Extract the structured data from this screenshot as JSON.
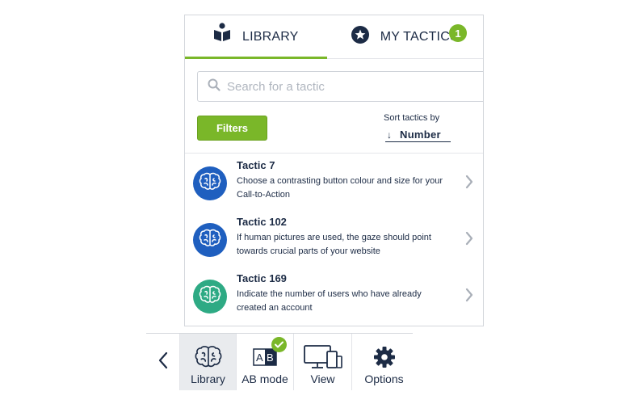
{
  "tabs": [
    {
      "label": "LIBRARY",
      "icon": "book-reader-icon",
      "active": true
    },
    {
      "label": "MY TACTICS",
      "icon": "star-icon",
      "badge": "1"
    }
  ],
  "search": {
    "placeholder": "Search for a tactic",
    "value": ""
  },
  "filters_label": "Filters",
  "sort": {
    "label": "Sort tactics by",
    "value": "Number",
    "direction_icon": "arrow-down-icon"
  },
  "tactics": [
    {
      "title": "Tactic 7",
      "description": "Choose a contrasting button colour and size for your Call-to-Action",
      "color": "#1f5fbf"
    },
    {
      "title": "Tactic 102",
      "description": "If human pictures are used, the gaze should point towards crucial parts of your website",
      "color": "#1f5fbf"
    },
    {
      "title": "Tactic 169",
      "description": "Indicate the number of users who have already created an account",
      "color": "#2eaa84"
    }
  ],
  "toolbar": {
    "back_icon": "chevron-left-icon",
    "items": [
      {
        "label": "Library",
        "icon": "brain-icon",
        "active": true
      },
      {
        "label": "AB mode",
        "icon": "ab-icon",
        "checked": true
      },
      {
        "label": "View",
        "icon": "devices-icon"
      },
      {
        "label": "Options",
        "icon": "gear-icon"
      }
    ]
  },
  "colors": {
    "accent": "#7ab729",
    "text": "#1c2b45",
    "border": "#d4d7dc"
  }
}
